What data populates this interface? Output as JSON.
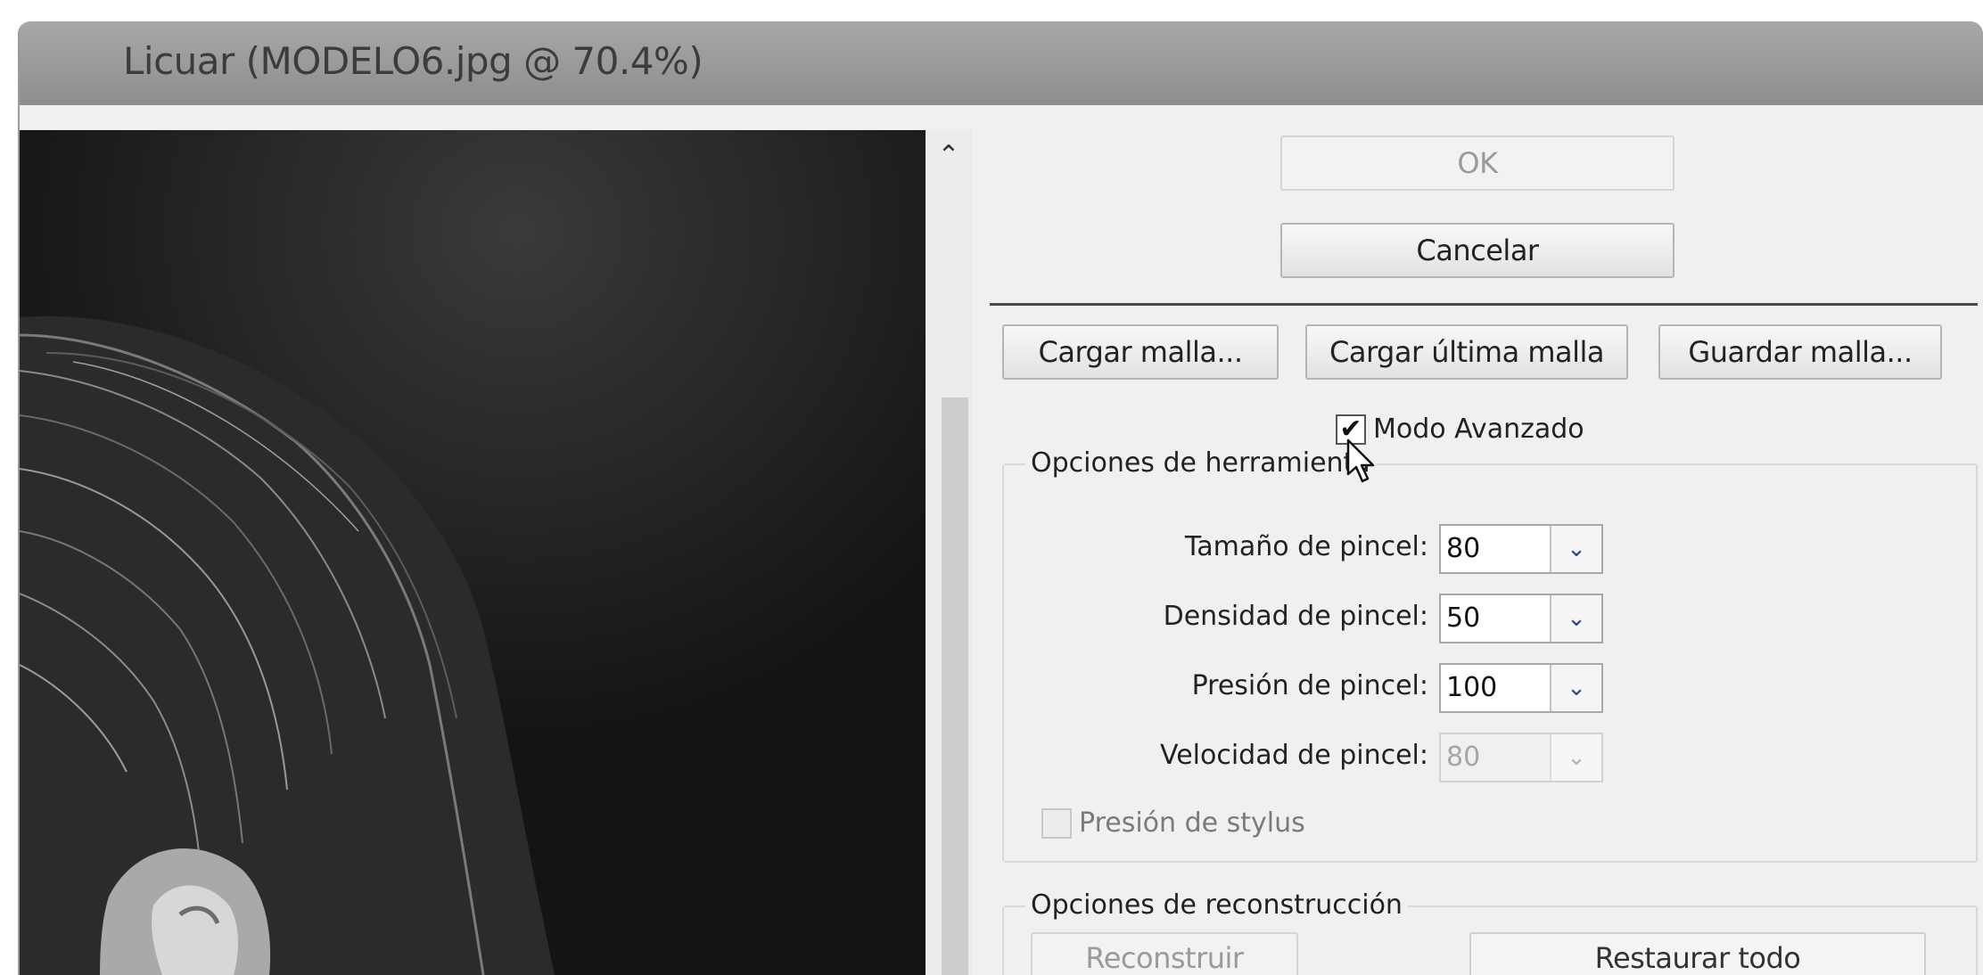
{
  "window": {
    "title": "Licuar (MODELO6.jpg @ 70.4%)"
  },
  "buttons": {
    "ok": "OK",
    "cancel": "Cancelar",
    "load_mesh": "Cargar malla...",
    "load_last_mesh": "Cargar última malla",
    "save_mesh": "Guardar malla...",
    "reconstruct": "Reconstruir",
    "restore_all": "Restaurar todo"
  },
  "advanced_mode": {
    "label": "Modo Avanzado",
    "checked": true
  },
  "tool_options": {
    "title": "Opciones de herramienta",
    "brush_size": {
      "label": "Tamaño de pincel:",
      "value": "80"
    },
    "brush_density": {
      "label": "Densidad de pincel:",
      "value": "50"
    },
    "brush_pressure": {
      "label": "Presión de pincel:",
      "value": "100"
    },
    "brush_rate": {
      "label": "Velocidad de pincel:",
      "value": "80",
      "disabled": true
    },
    "stylus_pressure": {
      "label": "Presión de stylus",
      "checked": false,
      "disabled": true
    }
  },
  "reconstruct_options": {
    "title": "Opciones de reconstrucción"
  },
  "icons": {
    "scroll_up": "chevron-up-icon",
    "dropdown": "chevron-down-icon",
    "check": "check-icon",
    "cursor": "arrow-cursor-icon"
  }
}
